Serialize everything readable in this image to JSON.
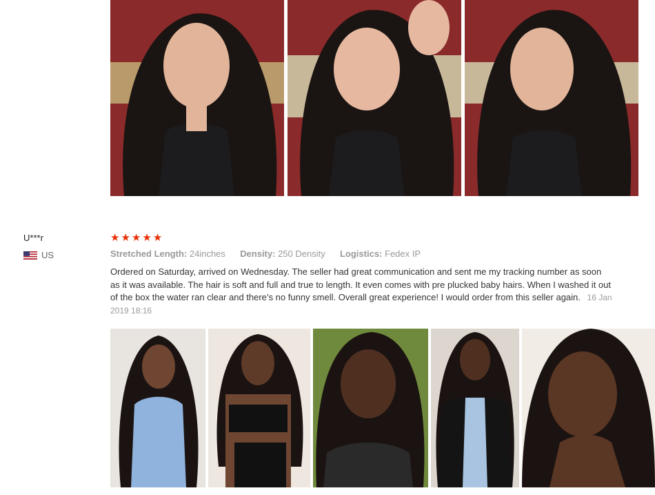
{
  "review": {
    "reviewer_name": "U***r",
    "country_flag_icon": "us-flag-icon",
    "country": "US",
    "rating": 5,
    "star_color": "#e62e04",
    "attributes": [
      {
        "key": "Stretched Length:",
        "value": "24inches"
      },
      {
        "key": "Density:",
        "value": "250 Density"
      },
      {
        "key": "Logistics:",
        "value": "Fedex IP"
      }
    ],
    "text": "Ordered on Saturday, arrived on Wednesday. The seller had great communication and sent me my tracking number as soon as it was available. The hair is soft and full and true to length. It even comes with pre plucked baby hairs. When I washed it out of the box the water ran clear and there’s no funny smell. Overall great experience! I would order from this seller again.",
    "date": "16 Jan 2019 18:16"
  }
}
